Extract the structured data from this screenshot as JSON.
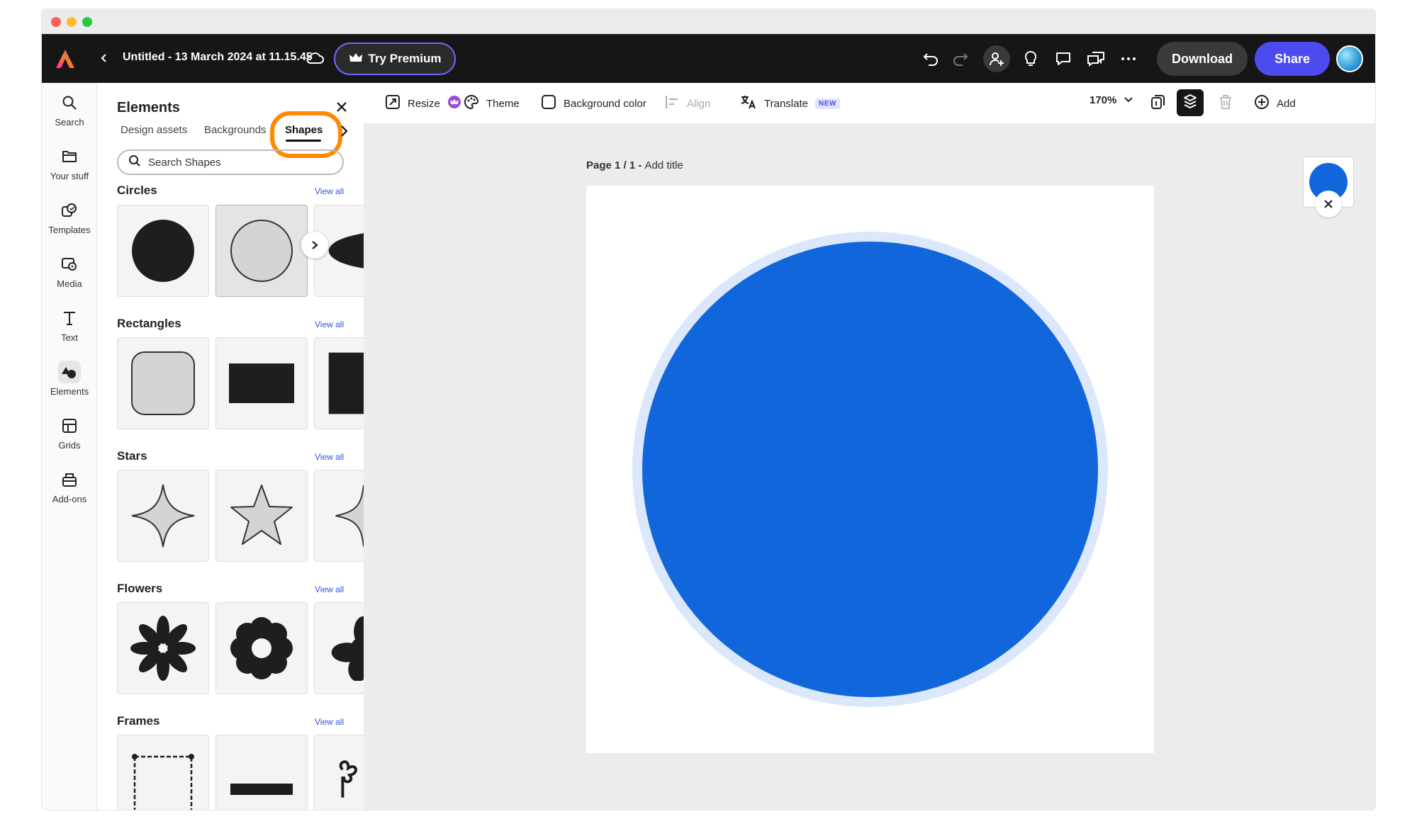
{
  "window": {
    "traffic_lights": [
      "#ff5f57",
      "#febc2e",
      "#28c840"
    ]
  },
  "topbar": {
    "document_title": "Untitled - 13 March 2024 at 11.15.45",
    "try_premium_label": "Try Premium",
    "download_label": "Download",
    "share_label": "Share",
    "icons": [
      "adobe-express-logo-icon",
      "back-chevron-icon",
      "cloud-icon",
      "crown-icon",
      "undo-icon",
      "redo-icon",
      "invite-user-icon",
      "lightbulb-icon",
      "comment-icon",
      "share-comments-icon",
      "more-icon"
    ]
  },
  "left_rail": {
    "items": [
      {
        "label": "Search",
        "icon": "search-icon"
      },
      {
        "label": "Your stuff",
        "icon": "folder-icon"
      },
      {
        "label": "Templates",
        "icon": "templates-icon"
      },
      {
        "label": "Media",
        "icon": "media-icon"
      },
      {
        "label": "Text",
        "icon": "text-icon"
      },
      {
        "label": "Elements",
        "icon": "elements-icon",
        "active": true
      },
      {
        "label": "Grids",
        "icon": "grids-icon"
      },
      {
        "label": "Add-ons",
        "icon": "add-ons-icon"
      }
    ]
  },
  "panel": {
    "title": "Elements",
    "tabs": [
      "Design assets",
      "Backgrounds",
      "Shapes"
    ],
    "active_tab": "Shapes",
    "search_placeholder": "Search Shapes",
    "view_all_label": "View all",
    "sections": [
      {
        "title": "Circles"
      },
      {
        "title": "Rectangles"
      },
      {
        "title": "Stars"
      },
      {
        "title": "Flowers"
      },
      {
        "title": "Frames"
      }
    ]
  },
  "toolbar": {
    "resize_label": "Resize",
    "theme_label": "Theme",
    "background_label": "Background color",
    "align_label": "Align",
    "translate_label": "Translate",
    "new_badge": "NEW",
    "zoom_label": "170%",
    "add_label": "Add"
  },
  "canvas": {
    "page_prefix": "Page 1 / 1 - ",
    "page_title_placeholder": "Add title",
    "shape_color": "#1266db",
    "selection_halo_color": "#dbe7fb"
  },
  "colors": {
    "accent": "#4b4bf0",
    "highlight": "#ff8a00",
    "topbar_bg": "#161616"
  }
}
